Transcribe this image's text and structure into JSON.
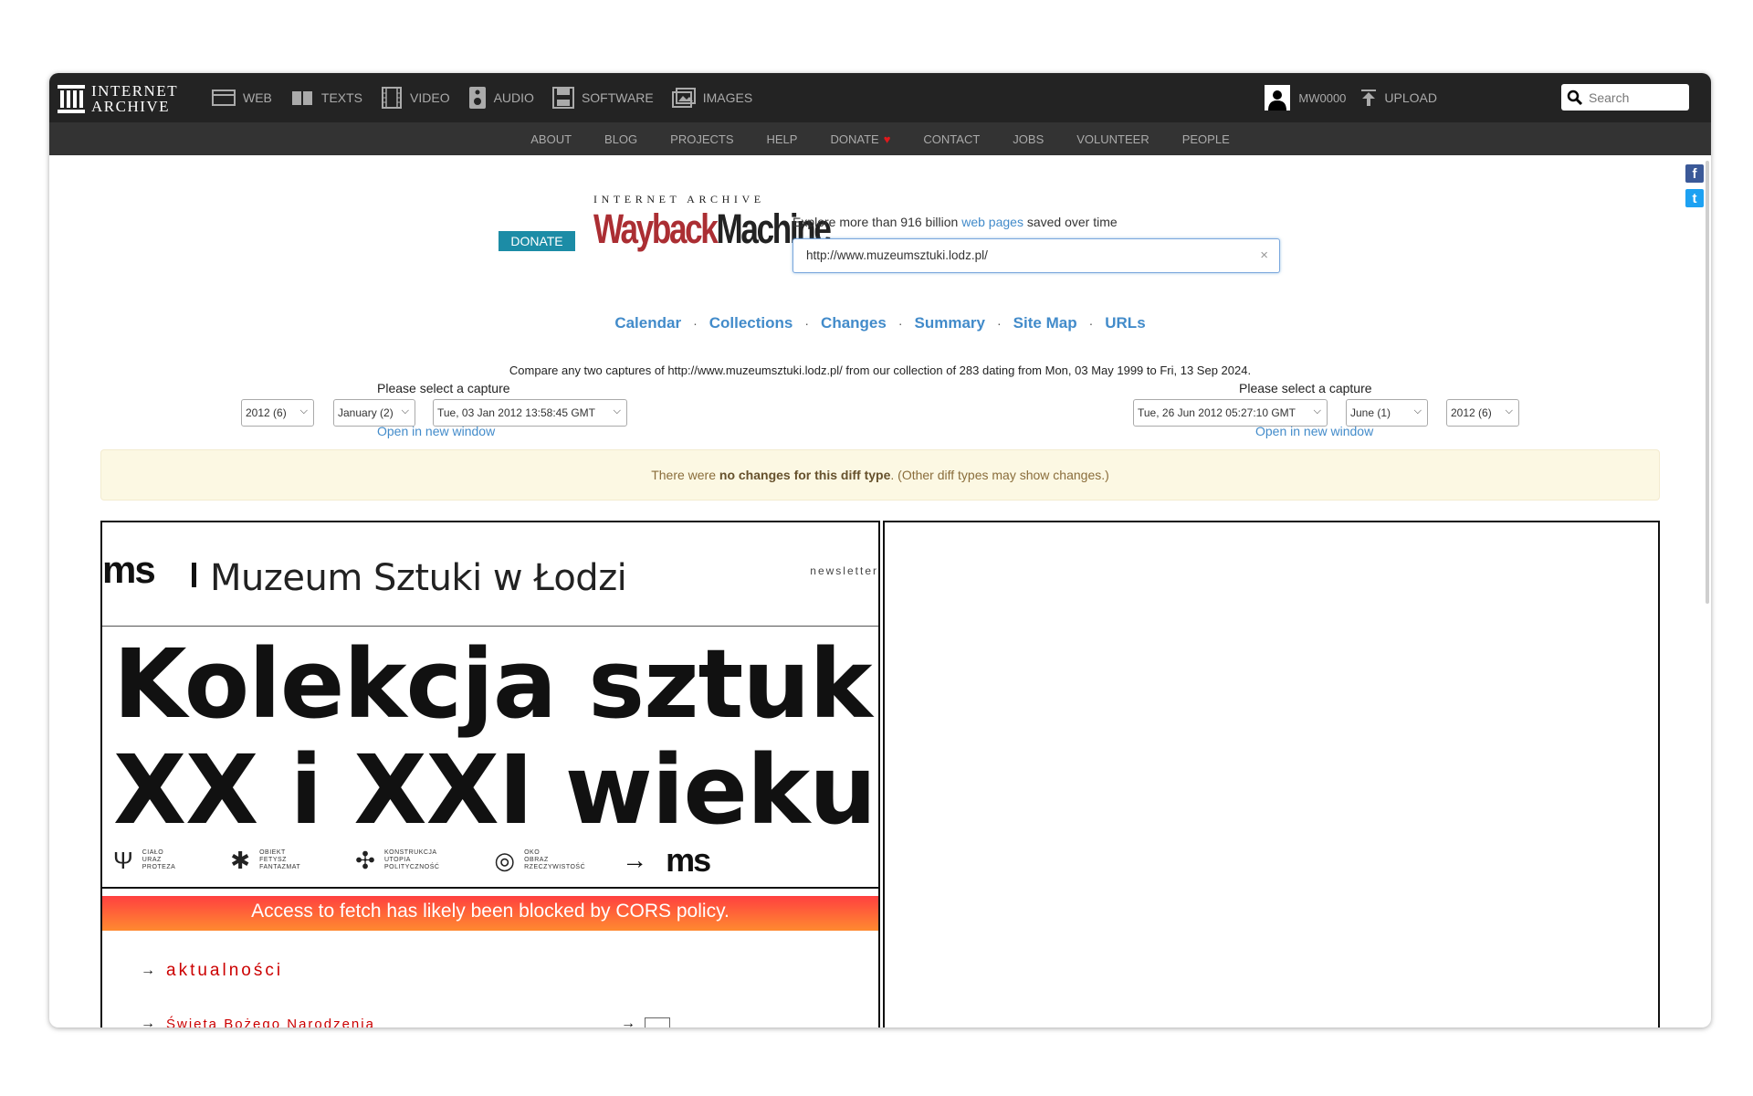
{
  "topbar": {
    "logo_line1": "INTERNET",
    "logo_line2": "ARCHIVE",
    "media": [
      {
        "label": "WEB",
        "icon": "web-icon"
      },
      {
        "label": "TEXTS",
        "icon": "texts-icon"
      },
      {
        "label": "VIDEO",
        "icon": "video-icon"
      },
      {
        "label": "AUDIO",
        "icon": "audio-icon"
      },
      {
        "label": "SOFTWARE",
        "icon": "software-icon"
      },
      {
        "label": "IMAGES",
        "icon": "images-icon"
      }
    ],
    "username": "MW0000",
    "upload_label": "UPLOAD",
    "search_placeholder": "Search"
  },
  "subnav": [
    "ABOUT",
    "BLOG",
    "PROJECTS",
    "HELP",
    "DONATE",
    "CONTACT",
    "JOBS",
    "VOLUNTEER",
    "PEOPLE"
  ],
  "social": {
    "facebook": "f",
    "twitter": "t"
  },
  "wayback": {
    "donate_label": "DONATE",
    "logo_top": "INTERNET ARCHIVE",
    "logo_word1": "Wayback",
    "logo_word2": "Machine",
    "explore_pre": "Explore more than 916 billion ",
    "explore_link": "web pages",
    "explore_post": " saved over time",
    "url_value": "http://www.muzeumsztuki.lodz.pl/",
    "clear": "×"
  },
  "tabs": [
    "Calendar",
    "Collections",
    "Changes",
    "Summary",
    "Site Map",
    "URLs"
  ],
  "tab_separator": "·",
  "compare_text": "Compare any two captures of http://www.muzeumsztuki.lodz.pl/ from our collection of 283 dating from Mon, 03 May 1999 to Fri, 13 Sep 2024.",
  "left_capture": {
    "label": "Please select a capture",
    "year": "2012 (6)",
    "month": "January (2)",
    "timestamp": "Tue, 03 Jan 2012 13:58:45 GMT",
    "open_link": "Open in new window"
  },
  "right_capture": {
    "label": "Please select a capture",
    "timestamp": "Tue, 26 Jun 2012 05:27:10 GMT",
    "month": "June (1)",
    "year": "2012 (6)",
    "open_link": "Open in new window"
  },
  "notice": {
    "pre": "There were ",
    "bold": "no changes for this diff type",
    "post": ". (Other diff types may show changes.)"
  },
  "left_pane": {
    "ms_logo": "ms",
    "title": "Muzeum Sztuki w Łodzi",
    "newsletter": "newsletter",
    "banner_line1": "Kolekcja sztuki",
    "banner_line2": "XX i XXI wieku",
    "banner_icons": [
      {
        "sym": "Ψ",
        "text": [
          "CIAŁO",
          "URAZ",
          "PROTEZA"
        ]
      },
      {
        "sym": "✱",
        "text": [
          "OBIEKT",
          "FETYSZ",
          "FANTAZMAT"
        ]
      },
      {
        "sym": "✣",
        "text": [
          "KONSTRUKCJA",
          "UTOPIA",
          "POLITYCZNOŚĆ"
        ]
      },
      {
        "sym": "◎",
        "text": [
          "OKO",
          "OBRAZ",
          "RZECZYWISTOŚĆ"
        ]
      }
    ],
    "banner_arrow": "→",
    "banner_ms": "ms",
    "cors_message": "Access to fetch has likely been blocked by CORS policy.",
    "news_label": "aktualności",
    "news_item": "Święta Bożego Narodzenia",
    "arrow": "→"
  }
}
